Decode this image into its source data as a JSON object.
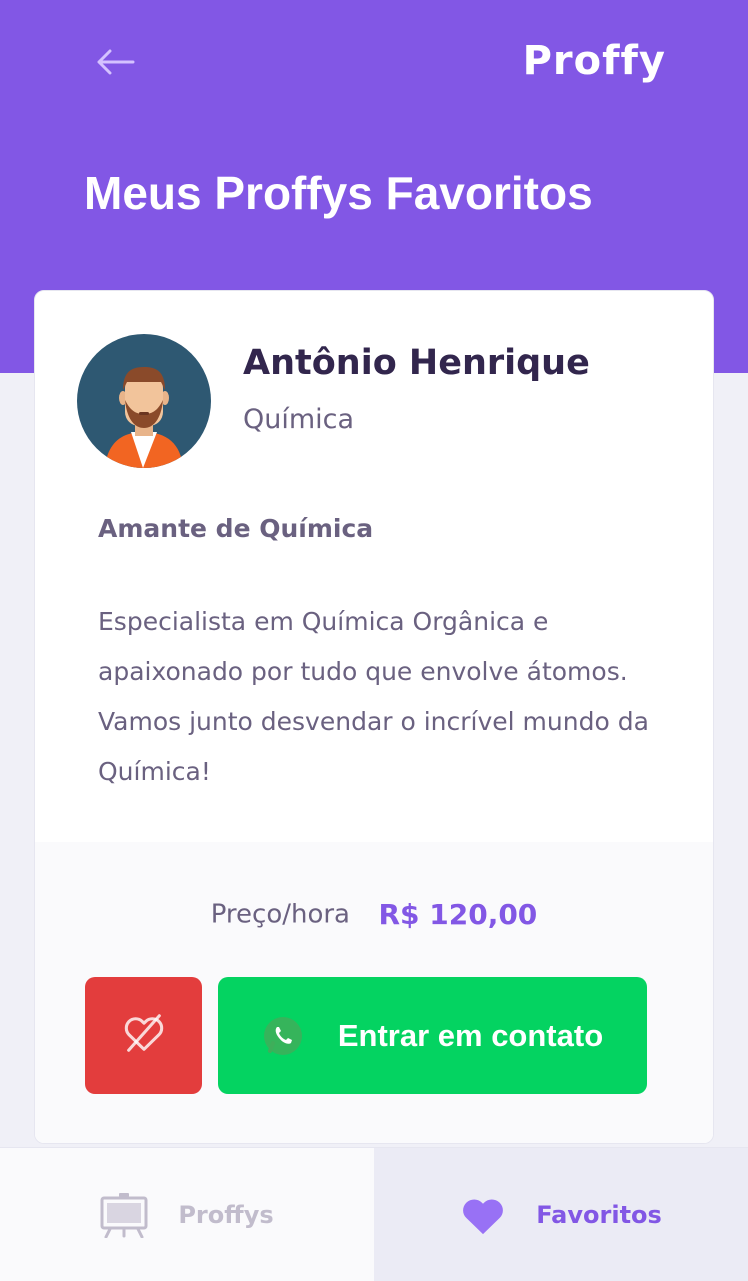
{
  "header": {
    "back_icon": "arrow-left-icon",
    "logo_text": "Proffy",
    "title": "Meus Proffys Favoritos"
  },
  "teacher_card": {
    "avatar_icon": "avatar-illustration",
    "name": "Antônio Henrique",
    "subject": "Química",
    "bio_title": "Amante de Química",
    "bio": "Especialista em Química Orgânica e apaixonado por tudo que envolve átomos. Vamos junto desvendar o incrível mundo da Química!",
    "price_label": "Preço/hora",
    "price_value": "R$ 120,00",
    "unfavorite_icon": "heart-outline-crossed-icon",
    "contact_icon": "whatsapp-icon",
    "contact_label": "Entrar em contato"
  },
  "tabbar": {
    "tabs": [
      {
        "label": "Proffys",
        "icon": "easel-icon",
        "active": false
      },
      {
        "label": "Favoritos",
        "icon": "heart-icon",
        "active": true
      }
    ]
  },
  "colors": {
    "primary": "#8257E5",
    "background": "#F0F0F7",
    "title_text": "#32264D",
    "body_text": "#6A6180",
    "danger": "#E33D3D",
    "success": "#04D361",
    "inactive": "#C1BCCC"
  }
}
